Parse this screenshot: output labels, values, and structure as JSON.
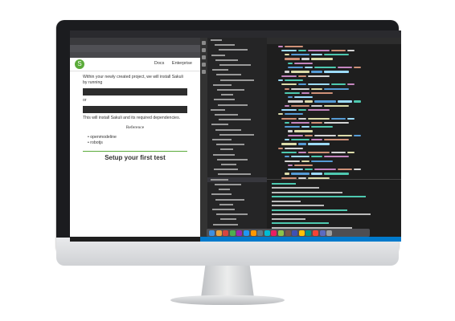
{
  "browser": {
    "nav_docs": "Docs",
    "nav_enterprise": "Enterprise",
    "intro": "Within your newly created project, we will install Sakuli by running",
    "or_text": "or",
    "install_note": "This will install Sakuli and its required dependencies.",
    "reference_heading": "Reference",
    "bullet_1": "openmodeline",
    "bullet_2": "robotjs",
    "setup_heading": "Setup your first test"
  },
  "icons": [
    "sakuli-logo-icon",
    "explorer-icon",
    "search-icon",
    "source-control-icon",
    "debug-icon",
    "extensions-icon"
  ],
  "colors": {
    "accent": "#5bab3a",
    "vscode_status": "#007acc",
    "editor_bg": "#1e1e1e"
  }
}
